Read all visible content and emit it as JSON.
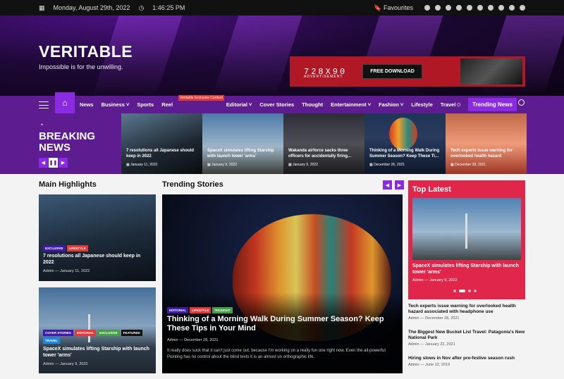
{
  "topbar": {
    "date": "Monday, August 29th, 2022",
    "time": "1:46:25 PM",
    "favourites": "Favourites"
  },
  "header": {
    "logo": "VERITABLE",
    "tagline": "Impossible is for the unwilling.",
    "ad_size": "728X90",
    "ad_label": "ADVERTISEMENT",
    "ad_button": "FREE DOWNLOAD"
  },
  "nav": {
    "items": [
      "News",
      "Business",
      "Sports",
      "Reel",
      "Editorial",
      "Cover Stories",
      "Thought",
      "Entertainment",
      "Fashion",
      "Lifestyle",
      "Travel"
    ],
    "editorial_badge": "Veritable Exclusive Content",
    "trending_button": "Trending News"
  },
  "breaking": {
    "title_line1": "BREAKING",
    "title_line2": "NEWS",
    "slides": [
      {
        "title": "7 resolutions all Japanese should keep in 2022",
        "date": "January 11, 2022"
      },
      {
        "title": "SpaceX simulates lifting Starship with launch tower 'arms'",
        "date": "January 9, 2022"
      },
      {
        "title": "Wakanda airforce sacks three officers for accidentally firing...",
        "date": "January 9, 2022"
      },
      {
        "title": "Thinking of a Morning Walk During Summer Season? Keep These Ti...",
        "date": "December 26, 2021"
      },
      {
        "title": "Tech experts issue warning for overlooked health hazard",
        "date": "December 28, 2021"
      }
    ]
  },
  "main_highlights": {
    "heading": "Main Highlights",
    "cards": [
      {
        "tags": [
          "EXCLUSIVE",
          "LIFESTYLE"
        ],
        "title": "7 resolutions all Japanese should keep in 2022",
        "author": "Admin",
        "date": "January 11, 2022"
      },
      {
        "tags": [
          "COVER STORIES",
          "EDITORIAL",
          "EXCLUSIVE",
          "FEATURED",
          "TRAVEL"
        ],
        "title": "SpaceX simulates lifting Starship with launch tower 'arms'",
        "author": "Admin",
        "date": "January 9, 2022"
      }
    ]
  },
  "trending": {
    "heading": "Trending Stories",
    "tags": [
      "EDITORIAL",
      "LIFESTYLE",
      "THOUGHT"
    ],
    "title": "Thinking of a Morning Walk During Summer Season? Keep These Tips in Your Mind",
    "author": "Admin",
    "date": "December 28, 2021",
    "excerpt": "It really does suck that it can't just come out, because I'm working on a really fun one right now. Even the all-powerful Pointing has no control about the blind texts it is an almost un orthographic life."
  },
  "top_latest": {
    "heading": "Top Latest",
    "featured": {
      "title": "SpaceX simulates lifting Starship with launch tower 'arms'",
      "author": "Admin",
      "date": "January 9, 2022"
    },
    "list": [
      {
        "title": "Tech experts issue warning for overlooked health hazard associated with headphone use",
        "author": "Admin",
        "date": "December 28, 2021"
      },
      {
        "title": "The Biggest New Bucket List Travel: Patagonia's New National Park",
        "author": "Admin",
        "date": "January 22, 2021"
      },
      {
        "title": "Hiring slows in Nov after pre-festive season rush",
        "author": "Admin",
        "date": "June 12, 2019"
      }
    ]
  },
  "colors": {
    "brand": "#5e1c91",
    "accent": "#8a2be2",
    "latest": "#e0264b"
  }
}
